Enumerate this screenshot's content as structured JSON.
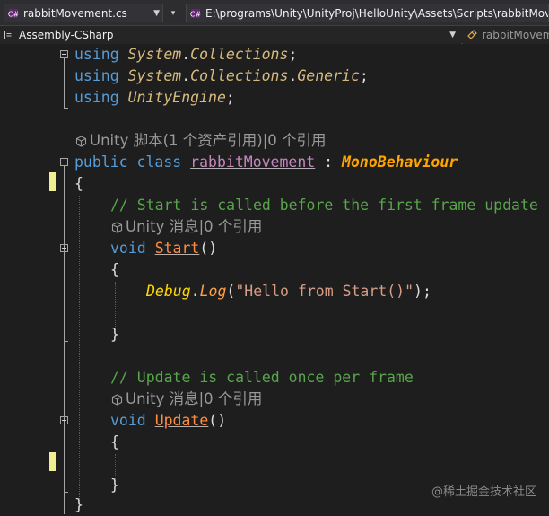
{
  "toolbar": {
    "file_dropdown": "rabbitMovement.cs",
    "path_dropdown": "E:\\programs\\Unity\\UnityProj\\HelloUnity\\Assets\\Scripts\\rabbitMovement.cs"
  },
  "navbar": {
    "project_dropdown": "Assembly-CSharp",
    "member_dropdown": "rabbitMovement"
  },
  "code": {
    "l1": {
      "kw": "using",
      "ns1": "System",
      "dot": ".",
      "ns2": "Collections",
      "semi": ";"
    },
    "l2": {
      "kw": "using",
      "ns1": "System",
      "dot1": ".",
      "ns2": "Collections",
      "dot2": ".",
      "ns3": "Generic",
      "semi": ";"
    },
    "l3": {
      "kw": "using",
      "ns1": "UnityEngine",
      "semi": ";"
    },
    "lens_class": "Unity 脚本(1 个资产引用)|0 个引用",
    "class_line": {
      "kw1": "public",
      "kw2": "class",
      "name": "rabbitMovement",
      "colon": " : ",
      "base": "MonoBehaviour"
    },
    "brace_open": "{",
    "comment_start": "// Start is called before the first frame update",
    "lens_start": "Unity 消息|0 个引用",
    "start_decl": {
      "kw": "void",
      "name": "Start",
      "parens": "()"
    },
    "start_open": "{",
    "debug_line": {
      "cls": "Debug",
      "dot": ".",
      "method": "Log",
      "lp": "(",
      "str": "\"Hello from Start()\"",
      "rp": ");"
    },
    "start_close": "}",
    "comment_update": "// Update is called once per frame",
    "lens_update": "Unity 消息|0 个引用",
    "update_decl": {
      "kw": "void",
      "name": "Update",
      "parens": "()"
    },
    "update_open": "{",
    "update_close": "}",
    "brace_close": "}"
  },
  "watermark": "@稀土掘金技术社区",
  "colors": {
    "background": "#1e1e1e",
    "keyword": "#569cd6",
    "type": "#d7ba7d",
    "comment": "#57a64a",
    "string": "#d69d85",
    "change_marker": "#efef91"
  }
}
